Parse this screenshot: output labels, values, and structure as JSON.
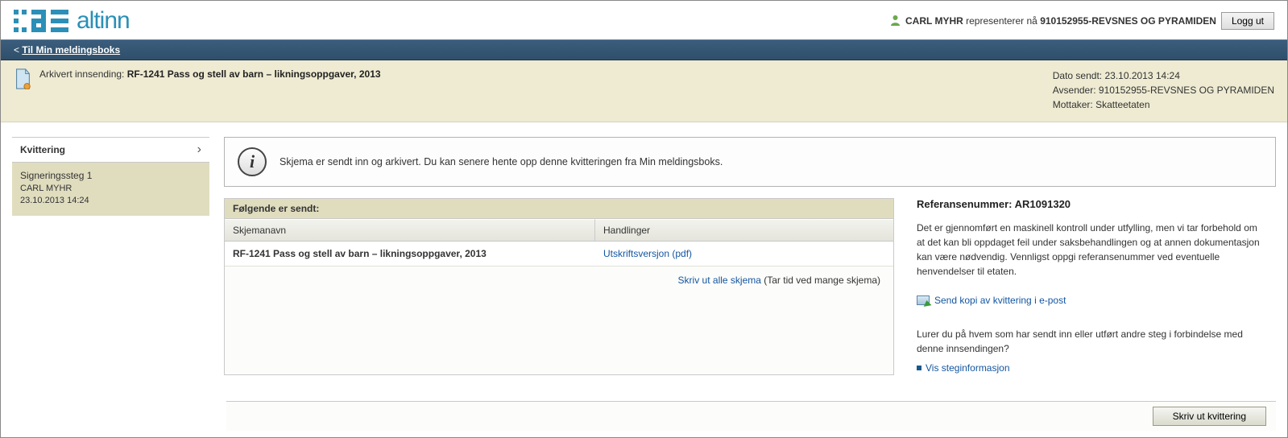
{
  "brand": "altinn",
  "header": {
    "user_name": "CARL MYHR",
    "represents_text": "representerer nå",
    "org": "910152955-REVSNES OG PYRAMIDEN",
    "logout": "Logg ut"
  },
  "nav": {
    "back": "Til Min meldingsboks"
  },
  "summary": {
    "prefix": "Arkivert innsending:",
    "title": "RF-1241 Pass og stell av barn – likningsoppgaver, 2013",
    "date_label": "Dato sendt:",
    "date": "23.10.2013 14:24",
    "sender_label": "Avsender:",
    "sender": "910152955-REVSNES OG PYRAMIDEN",
    "receiver_label": "Mottaker:",
    "receiver": "Skatteetaten"
  },
  "sidebar": {
    "head": "Kvittering",
    "step": {
      "title": "Signeringssteg 1",
      "user": "CARL MYHR",
      "time": "23.10.2013 14:24"
    }
  },
  "info": {
    "text": "Skjema er sendt inn og arkivert. Du kan senere hente opp denne kvitteringen fra Min meldingsboks."
  },
  "sent": {
    "head": "Følgende er sendt:",
    "col_name": "Skjemanavn",
    "col_actions": "Handlinger",
    "rows": [
      {
        "name": "RF-1241 Pass og stell av barn – likningsoppgaver, 2013",
        "action": "Utskriftsversjon (pdf)"
      }
    ],
    "print_all_link": "Skriv ut alle skjema",
    "print_all_note": "(Tar tid ved mange skjema)"
  },
  "right": {
    "ref_label": "Referansenummer:",
    "ref": "AR1091320",
    "body": "Det er gjennomført en maskinell kontroll under utfylling, men vi tar forbehold om at det kan bli oppdaget feil under saksbehandlingen og at annen dokumentasjon kan være nødvendig. Vennligst oppgi referansenummer ved eventuelle henvendelser til etaten.",
    "email": "Send kopi av kvittering i e-post",
    "step_q": "Lurer du på hvem som har sendt inn eller utført andre steg i forbindelse med denne innsendingen?",
    "step_link": "Vis steginformasjon"
  },
  "footer": {
    "print": "Skriv ut kvittering"
  }
}
